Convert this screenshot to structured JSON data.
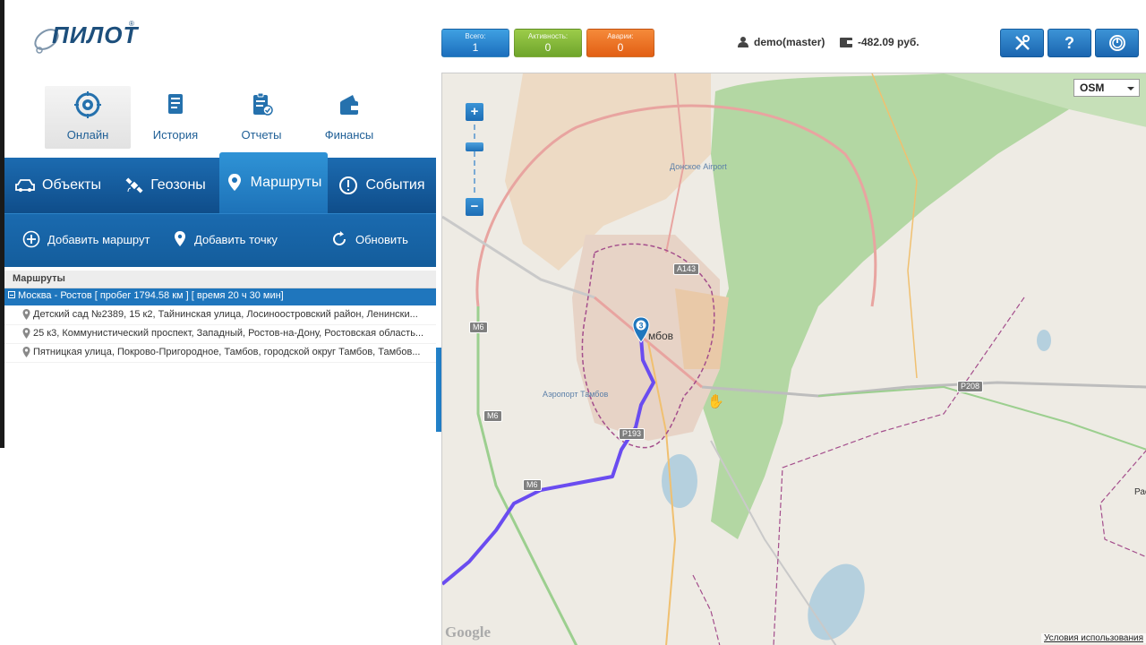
{
  "brand": {
    "logo_text": "ПИЛОТ",
    "logo_mark": "®"
  },
  "header": {
    "counters": [
      {
        "label": "Всего:",
        "value": "1",
        "color": "#1c6fbd"
      },
      {
        "label": "Активность:",
        "value": "0",
        "color": "#6fa52b"
      },
      {
        "label": "Аварии:",
        "value": "0",
        "color": "#e25f14"
      }
    ],
    "user": "demo(master)",
    "balance": "-482.09 руб.",
    "help_label": "?"
  },
  "main_nav": [
    {
      "label": "Онлайн",
      "icon": "target-icon",
      "active": true
    },
    {
      "label": "История",
      "icon": "document-icon",
      "active": false
    },
    {
      "label": "Отчеты",
      "icon": "report-icon",
      "active": false
    },
    {
      "label": "Финансы",
      "icon": "wallet-icon",
      "active": false
    }
  ],
  "tabs": [
    {
      "label": "Объекты",
      "icon": "car-icon"
    },
    {
      "label": "Геозоны",
      "icon": "satellite-icon"
    },
    {
      "label": "Маршруты",
      "icon": "route-pin-icon"
    },
    {
      "label": "События",
      "icon": "alert-icon"
    }
  ],
  "toolbar": {
    "add_route": "Добавить маршрут",
    "add_point": "Добавить точку",
    "refresh": "Обновить"
  },
  "routes": {
    "header": "Маршруты",
    "route": "Москва - Ростов [ пробег 1794.58 км ] [ время 20 ч 30 мин]",
    "points": [
      "Детский сад №2389, 15 к2, Тайнинская улица, Лосиноостровский район, Ленински...",
      "25 к3, Коммунистический проспект, Западный, Ростов-на-Дону, Ростовская область...",
      "Пятницкая улица, Покрово-Пригородное, Тамбов, городской округ Тамбов, Тамбов..."
    ]
  },
  "map": {
    "layer": "OSM",
    "zoom_in": "+",
    "zoom_out": "−",
    "city": "Тамбов",
    "city_partial": "мбов",
    "airport_north": "Донское Airport",
    "airport_west": "Аэропорт Тамбов",
    "marker_number": "3",
    "roads": [
      "A143",
      "M6",
      "M6",
      "M6",
      "P208",
      "P193"
    ],
    "edge_label": "Рас",
    "google": "Google",
    "terms": "Условия использования",
    "colors": {
      "forest": "#a8d19a",
      "urban": "#e8cfb0",
      "route": "#6a4cf0",
      "primary_road": "#e88a88"
    }
  }
}
